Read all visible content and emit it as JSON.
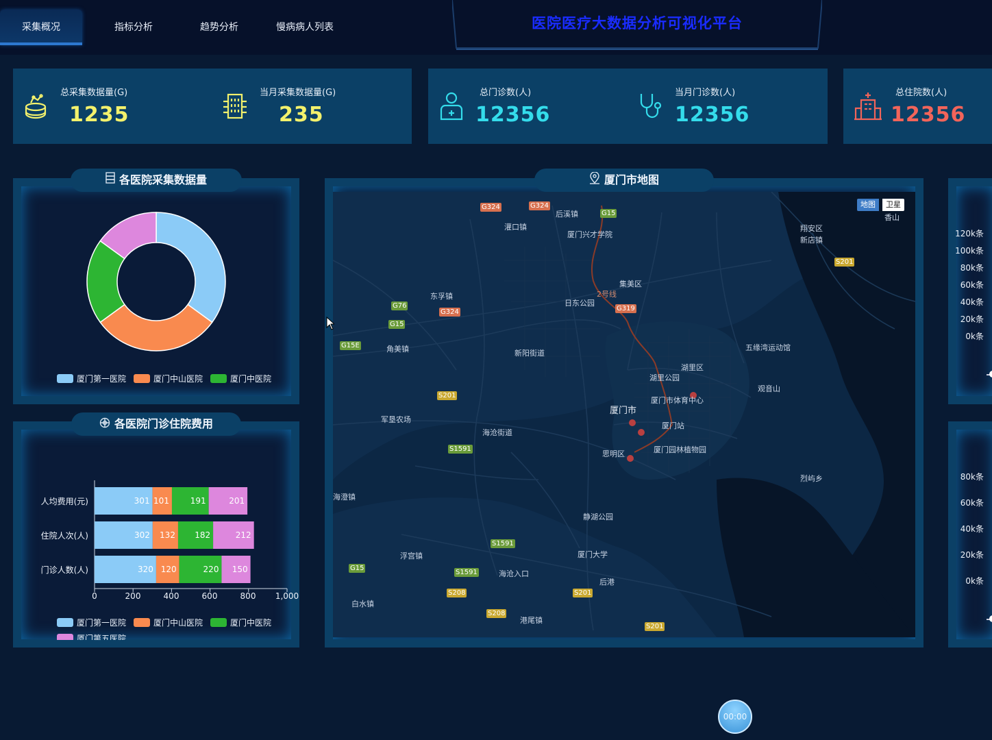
{
  "nav": {
    "tabs": [
      {
        "label": "采集概况",
        "active": true
      },
      {
        "label": "指标分析",
        "active": false
      },
      {
        "label": "趋势分析",
        "active": false
      },
      {
        "label": "慢病病人列表",
        "active": false
      }
    ]
  },
  "header": {
    "title": "医院医疗大数据分析可视化平台"
  },
  "stats": [
    {
      "label": "总采集数据量(G)",
      "value": "1235",
      "icon": "database-icon",
      "color": "#f3f16c"
    },
    {
      "label": "当月采集数据量(G)",
      "value": "235",
      "icon": "building-icon",
      "color": "#f3f16c"
    },
    {
      "label": "总门诊数(人)",
      "value": "12356",
      "icon": "doctor-icon",
      "color": "#34dceb"
    },
    {
      "label": "当月门诊数(人)",
      "value": "12356",
      "icon": "stethoscope-icon",
      "color": "#34dceb"
    },
    {
      "label": "总住院数(人)",
      "value": "12356",
      "icon": "hospital-icon",
      "color": "#f2645a"
    }
  ],
  "panels": {
    "collection": {
      "title": "各医院采集数据量",
      "icon": "server-icon"
    },
    "cost": {
      "title": "各医院门诊住院费用",
      "icon": "compass-icon"
    },
    "map": {
      "title": "厦门市地图",
      "icon": "location-icon"
    }
  },
  "colors": {
    "s1": "#8bcbf7",
    "s2": "#f98a4f",
    "s3": "#2db533",
    "s4": "#dd87dd"
  },
  "chart_data": [
    {
      "type": "pie",
      "labels": [
        "厦门第一医院",
        "厦门中山医院",
        "厦门中医院",
        ""
      ],
      "values": [
        35,
        30,
        20,
        15
      ],
      "legend": [
        "厦门第一医院",
        "厦门中山医院",
        "厦门中医院"
      ],
      "legend_position": "bottom"
    },
    {
      "type": "bar",
      "orientation": "horizontal",
      "stacked": true,
      "categories": [
        "人均费用(元)",
        "住院人次(人)",
        "门诊人数(人)"
      ],
      "series": [
        {
          "name": "厦门第一医院",
          "values": [
            301,
            302,
            320
          ]
        },
        {
          "name": "厦门中山医院",
          "values": [
            101,
            132,
            120
          ]
        },
        {
          "name": "厦门中医院",
          "values": [
            191,
            182,
            220
          ]
        },
        {
          "name": "厦门第五医院",
          "values": [
            201,
            212,
            150
          ]
        }
      ],
      "xticks": [
        "0",
        "200",
        "400",
        "600",
        "800",
        "1,000"
      ],
      "xlim": [
        0,
        1000
      ],
      "legend_position": "bottom"
    }
  ],
  "map": {
    "toggle": [
      "地图",
      "卫星"
    ],
    "labels": [
      {
        "t": "后溪镇"
      },
      {
        "t": "灌口镇"
      },
      {
        "t": "厦门兴才学院"
      },
      {
        "t": "集美区"
      },
      {
        "t": "日东公园"
      },
      {
        "t": "东孚镇"
      },
      {
        "t": "新阳街道"
      },
      {
        "t": "角美镇"
      },
      {
        "t": "翔安区"
      },
      {
        "t": "新店镇"
      },
      {
        "t": "香山"
      },
      {
        "t": "五缘湾运动馆"
      },
      {
        "t": "湖里区"
      },
      {
        "t": "湖里公园"
      },
      {
        "t": "观音山"
      },
      {
        "t": "厦门市体育中心"
      },
      {
        "t": "厦门市"
      },
      {
        "t": "厦门站"
      },
      {
        "t": "厦门园林植物园"
      },
      {
        "t": "思明区"
      },
      {
        "t": "军垦农场"
      },
      {
        "t": "海沧街道"
      },
      {
        "t": "海澄镇"
      },
      {
        "t": "静湖公园"
      },
      {
        "t": "烈屿乡"
      },
      {
        "t": "浮宫镇"
      },
      {
        "t": "厦门大学"
      },
      {
        "t": "海沧入口"
      },
      {
        "t": "白水镇"
      },
      {
        "t": "后港"
      },
      {
        "t": "港尾镇"
      },
      {
        "t": "2号线"
      }
    ],
    "roads": [
      {
        "t": "G324"
      },
      {
        "t": "G324"
      },
      {
        "t": "G15"
      },
      {
        "t": "G76"
      },
      {
        "t": "G324"
      },
      {
        "t": "G15"
      },
      {
        "t": "G15E"
      },
      {
        "t": "G319"
      },
      {
        "t": "S201"
      },
      {
        "t": "S201"
      },
      {
        "t": "S1591"
      },
      {
        "t": "S1591"
      },
      {
        "t": "S1591"
      },
      {
        "t": "G15"
      },
      {
        "t": "S208"
      },
      {
        "t": "S208"
      },
      {
        "t": "S201"
      },
      {
        "t": "S201"
      }
    ]
  },
  "right_panels": {
    "top_ticks": [
      "120k条",
      "100k条",
      "80k条",
      "60k条",
      "40k条",
      "20k条",
      "0k条"
    ],
    "bottom_ticks": [
      "80k条",
      "60k条",
      "40k条",
      "20k条",
      "0k条"
    ]
  },
  "timer": {
    "label": "00:00"
  }
}
